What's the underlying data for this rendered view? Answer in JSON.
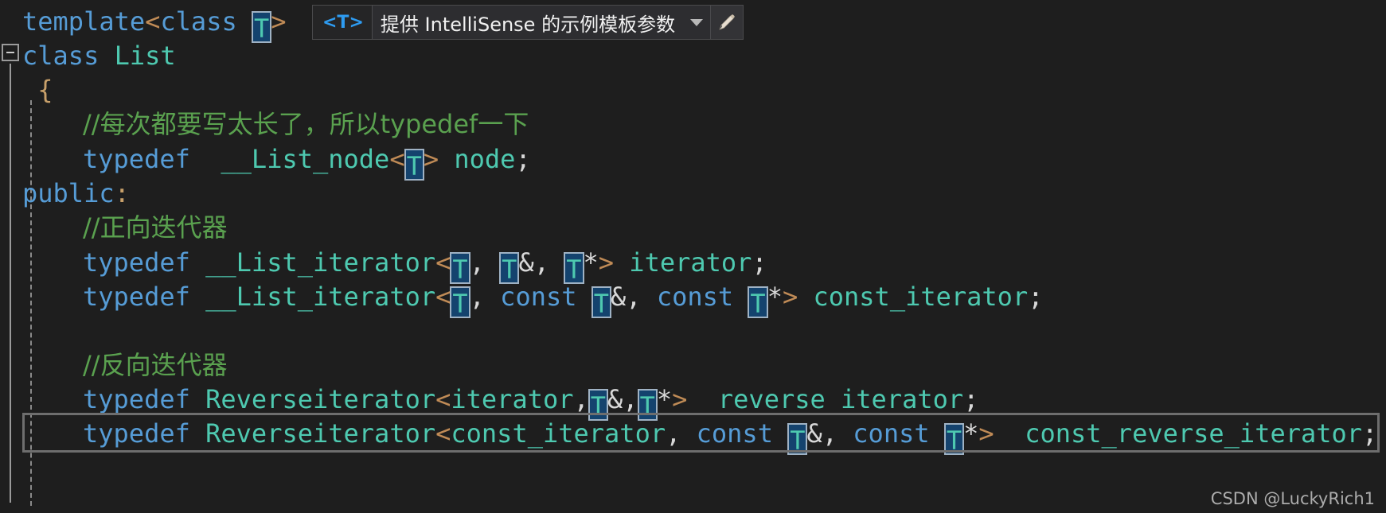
{
  "editor": {
    "background_color": "#1e1e1e",
    "colors": {
      "keyword": "#569cd6",
      "type": "#4ec9b0",
      "comment": "#5aa14f",
      "punctuation": "#d8d8d8",
      "angle_bracket": "#c08b56",
      "highlight_fill": "#14436e",
      "highlight_border": "#9fb2c4",
      "current_line_border": "#6e6e6e"
    },
    "lines": [
      {
        "n": 0,
        "text": "template<class T>"
      },
      {
        "n": 1,
        "text": "class List"
      },
      {
        "n": 2,
        "text": "{"
      },
      {
        "n": 3,
        "text": "    //每次都要写太长了，所以typedef一下"
      },
      {
        "n": 4,
        "text": "    typedef __List_node<T> node;"
      },
      {
        "n": 5,
        "text": "public:"
      },
      {
        "n": 6,
        "text": "    //正向迭代器"
      },
      {
        "n": 7,
        "text": "    typedef __List_iterator<T, T&, T*> iterator;"
      },
      {
        "n": 8,
        "text": "    typedef __List_iterator<T, const T&, const T*> const_iterator;"
      },
      {
        "n": 9,
        "text": ""
      },
      {
        "n": 10,
        "text": "    //反向迭代器"
      },
      {
        "n": 11,
        "text": "    typedef Reverseiterator<iterator,T&,T*>  reverse_iterator;"
      },
      {
        "n": 12,
        "text": "    typedef Reverseiterator<const_iterator, const T&, const T*>  const_reverse_iterator;"
      }
    ],
    "tokens": {
      "template": "template",
      "class": "class",
      "typedef": "typedef",
      "public": "public",
      "const": "const",
      "list_name": "List",
      "list_node": "__List_node",
      "list_iterator": "__List_iterator",
      "reverse_iterator_tpl": "Reverseiterator",
      "node": "node",
      "iterator": "iterator",
      "const_iterator": "const_iterator",
      "reverse_iterator": "reverse_iterator",
      "const_reverse_iterator": "const_reverse_iterator",
      "T": "T",
      "comment_1": "//每次都要写太长了，所以typedef一下",
      "comment_2": "//正向迭代器",
      "comment_3": "//反向迭代器",
      "open_brace": "{",
      "semicolon": ";",
      "comma": ",",
      "colon": ":",
      "amp": "&",
      "star": "*",
      "lt": "<",
      "gt": ">",
      "space": " "
    }
  },
  "tooltip": {
    "tag": "<T>",
    "description": "提供 IntelliSense 的示例模板参数",
    "chevron_icon": "chevron-down-icon",
    "edit_icon": "pencil-icon"
  },
  "gutter": {
    "fold_icon": "collapse-minus-icon"
  },
  "watermark": {
    "text": "CSDN @LuckyRich1"
  }
}
